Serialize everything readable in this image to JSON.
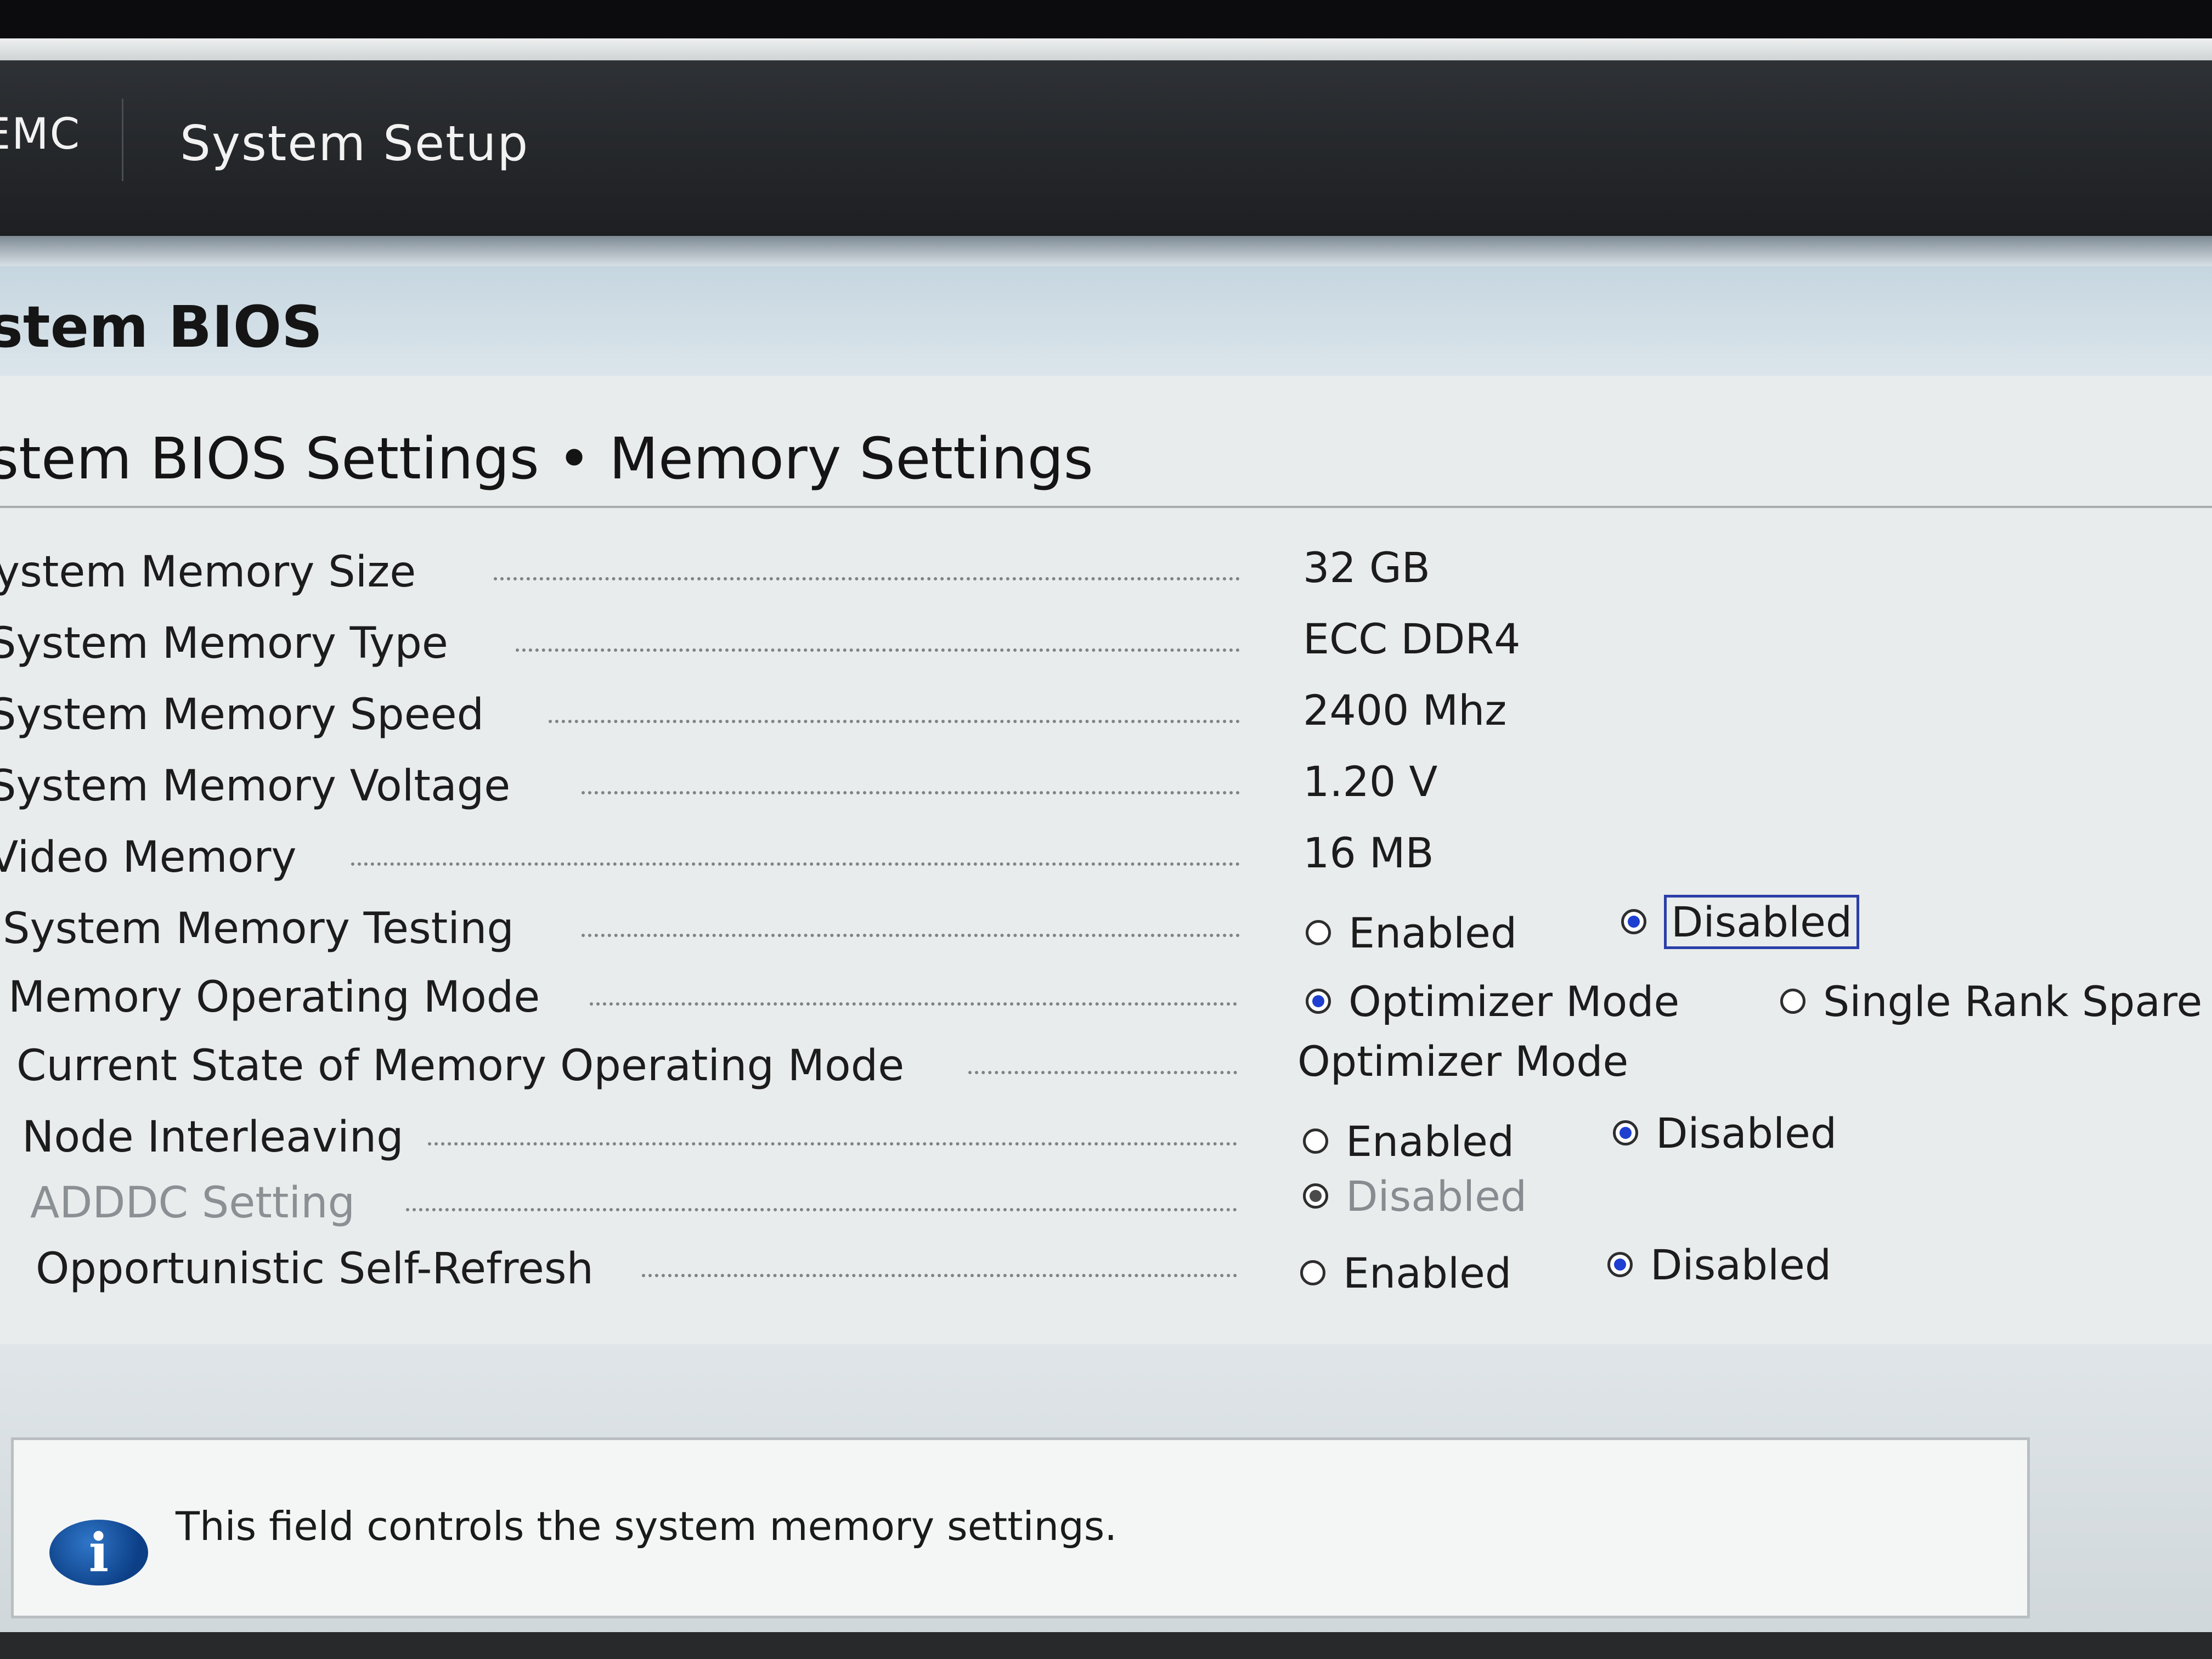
{
  "header": {
    "brand": "EMC",
    "title": "System Setup"
  },
  "section": {
    "title": "stem BIOS",
    "breadcrumb": "stem BIOS Settings • Memory Settings"
  },
  "settings": [
    {
      "label": "ystem Memory Size",
      "value": "32 GB"
    },
    {
      "label": "System Memory Type",
      "value": "ECC DDR4"
    },
    {
      "label": "System Memory Speed",
      "value": "2400 Mhz"
    },
    {
      "label": "System Memory Voltage",
      "value": "1.20 V"
    },
    {
      "label": "Video Memory",
      "value": "16 MB"
    },
    {
      "label": "System Memory Testing",
      "options": [
        "Enabled",
        "Disabled"
      ],
      "selected": "Disabled"
    },
    {
      "label": "Memory Operating Mode",
      "options": [
        "Optimizer Mode",
        "Single Rank Spare"
      ],
      "selected": "Optimizer Mode"
    },
    {
      "label": "Current State of Memory Operating Mode",
      "value": "Optimizer Mode"
    },
    {
      "label": "Node Interleaving",
      "options": [
        "Enabled",
        "Disabled"
      ],
      "selected": "Disabled"
    },
    {
      "label": "ADDDC Setting",
      "options": [
        "Disabled"
      ],
      "selected": "Disabled",
      "disabled": true
    },
    {
      "label": "Opportunistic Self-Refresh",
      "options": [
        "Enabled",
        "Disabled"
      ],
      "selected": "Disabled"
    }
  ],
  "help": {
    "icon": "info-icon",
    "text": "This field controls the system memory settings."
  },
  "colors": {
    "header_bg": "#1d1f22",
    "section_band": "#c6d6e0",
    "radio_selected": "#1e3fd0",
    "focus_border": "#2a3fa8"
  }
}
